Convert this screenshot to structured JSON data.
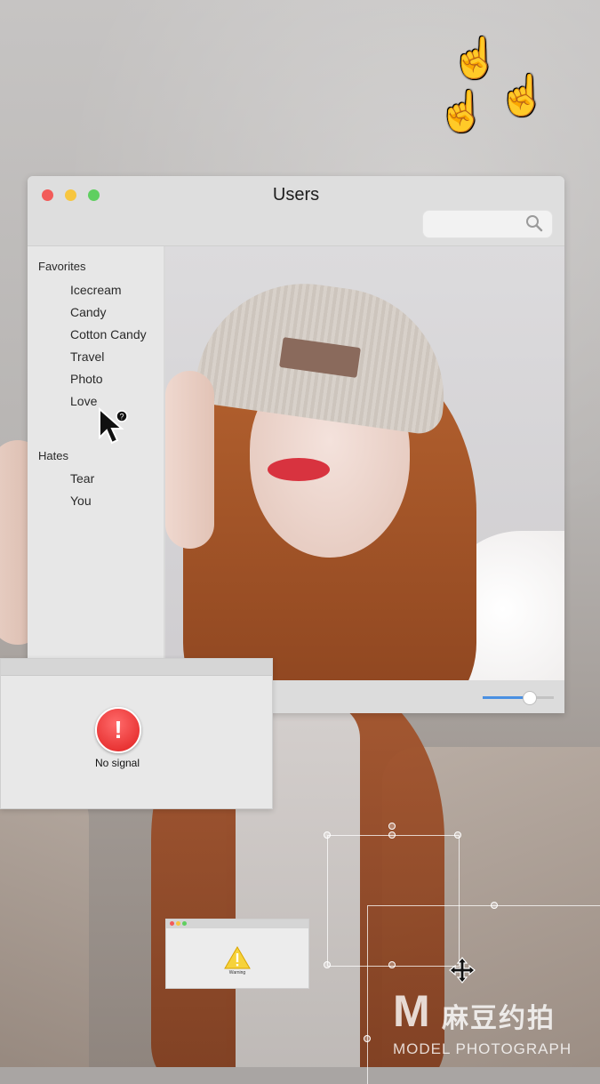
{
  "window": {
    "title": "Users",
    "search_placeholder": "",
    "sidebar": {
      "favorites_title": "Favorites",
      "favorites": [
        "Icecream",
        "Candy",
        "Cotton Candy",
        "Travel",
        "Photo",
        "Love"
      ],
      "hates_title": "Hates",
      "hates": [
        "Tear",
        "You"
      ]
    },
    "zoom_slider_value": 0.65,
    "accent_color": "#4a90e2"
  },
  "dialog_error": {
    "message": "No signal",
    "icon_glyph": "!"
  },
  "dialog_warning": {
    "message": "Warning"
  },
  "cursor_badge": "?",
  "watermark": {
    "cn": "麻豆约拍",
    "en": "MODEL PHOTOGRAPH"
  },
  "hand_cursor_glyph": "☝",
  "traffic_lights": {
    "close": "#f25b59",
    "minimize": "#f7c63f",
    "zoom": "#5fcf60"
  }
}
